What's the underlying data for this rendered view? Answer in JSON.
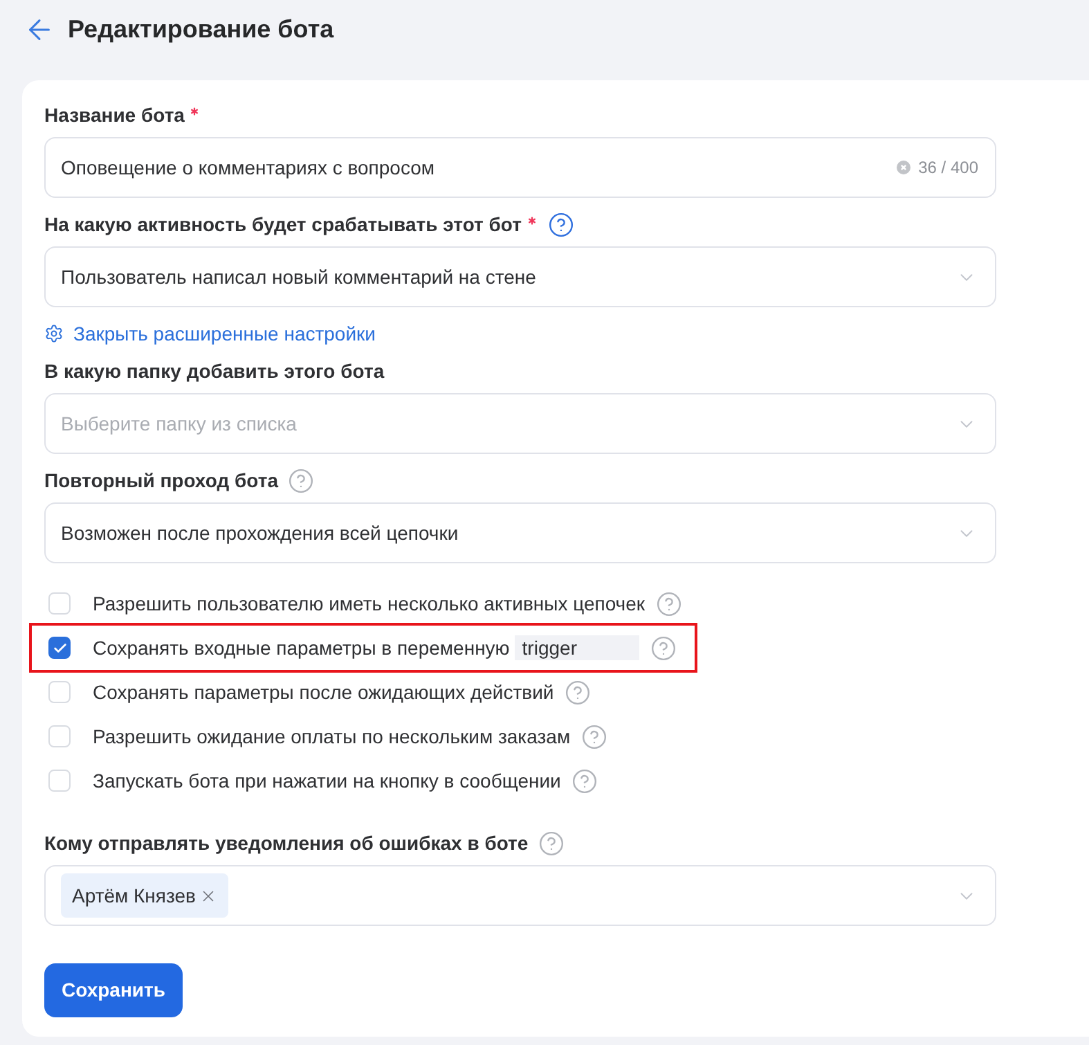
{
  "header": {
    "title": "Редактирование бота"
  },
  "form": {
    "fields": [
      {
        "kind": "text",
        "label": "Название бота",
        "required": true,
        "value": "Оповещение о комментариях с вопросом",
        "counter": "36 / 400"
      },
      {
        "kind": "select",
        "label": "На какую активность будет срабатывать этот бот",
        "required": true,
        "help": true,
        "help_active": true,
        "value": "Пользователь написал новый комментарий на стене"
      },
      {
        "kind": "link",
        "label": "Закрыть расширенные настройки"
      },
      {
        "kind": "select",
        "label": "В какую папку добавить этого бота",
        "required": false,
        "placeholder": "Выберите папку из списка"
      },
      {
        "kind": "select",
        "label": "Повторный проход бота",
        "required": false,
        "help": true,
        "help_active": false,
        "value": "Возможен после прохождения всей цепочки"
      },
      {
        "kind": "checkboxes",
        "options": [
          {
            "label": "Разрешить пользователю иметь несколько активных цепочек",
            "checked": false,
            "highlighted": false,
            "help": true
          },
          {
            "label": "Сохранять входные параметры в переменную",
            "checked": true,
            "highlighted": true,
            "variable": "trigger",
            "help": true
          },
          {
            "label": "Сохранять параметры после ожидающих действий",
            "checked": false,
            "highlighted": false,
            "help": true
          },
          {
            "label": "Разрешить ожидание оплаты по нескольким заказам",
            "checked": false,
            "highlighted": false,
            "help": true
          },
          {
            "label": "Запускать бота при нажатии на кнопку в сообщении",
            "checked": false,
            "highlighted": false,
            "help": true
          }
        ]
      },
      {
        "kind": "tags",
        "label": "Кому отправлять уведомления об ошибках в боте",
        "required": false,
        "help": true,
        "help_active": false,
        "tags": [
          {
            "label": "Артём Князев"
          }
        ]
      }
    ],
    "save_button": {
      "label": "Сохранить"
    }
  }
}
